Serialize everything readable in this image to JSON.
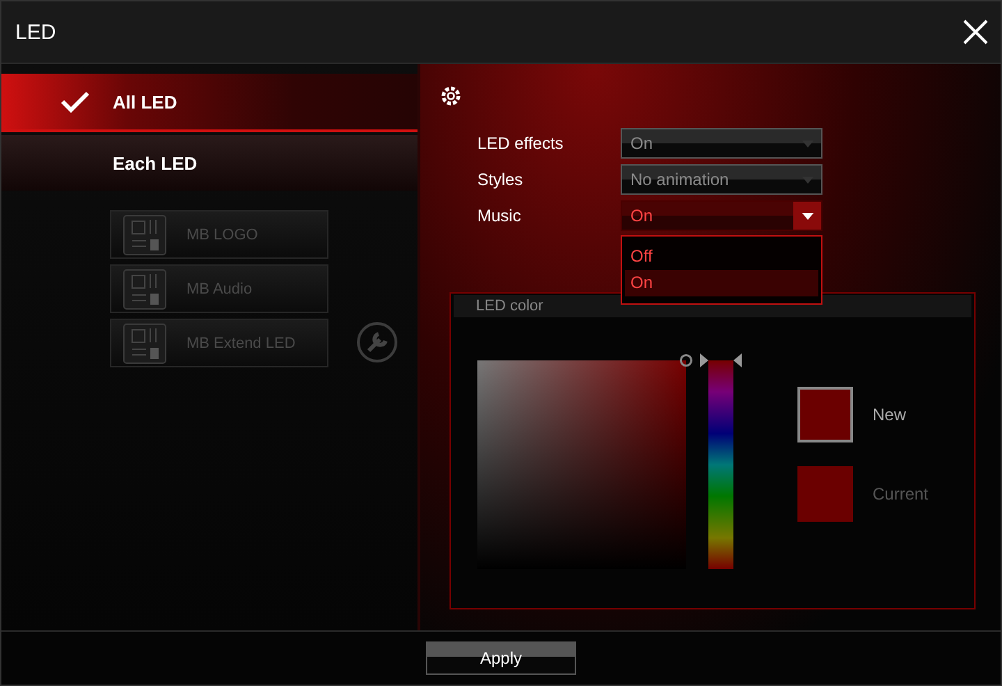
{
  "window": {
    "title": "LED"
  },
  "modes": [
    {
      "label": "All LED",
      "selected": true
    },
    {
      "label": "Each LED",
      "selected": false
    }
  ],
  "devices": [
    {
      "label": "MB LOGO",
      "disabled": true
    },
    {
      "label": "MB Audio",
      "disabled": true
    },
    {
      "label": "MB Extend LED",
      "disabled": true
    }
  ],
  "settings": [
    {
      "label": "LED effects",
      "value": "On",
      "disabled": true,
      "expanded": false
    },
    {
      "label": "Styles",
      "value": "No animation",
      "disabled": true,
      "expanded": false
    },
    {
      "label": "Music",
      "value": "On",
      "disabled": false,
      "expanded": true,
      "options": [
        {
          "label": "Off",
          "selected": false
        },
        {
          "label": "On",
          "selected": true
        }
      ]
    }
  ],
  "led_color": {
    "title": "LED color",
    "hue": {
      "level": 1
    },
    "swatches": [
      {
        "label": "New",
        "color": "#6b0000",
        "selected": true
      },
      {
        "label": "Current",
        "color": "#6b0000",
        "selected": false
      }
    ]
  },
  "apply": "Apply"
}
